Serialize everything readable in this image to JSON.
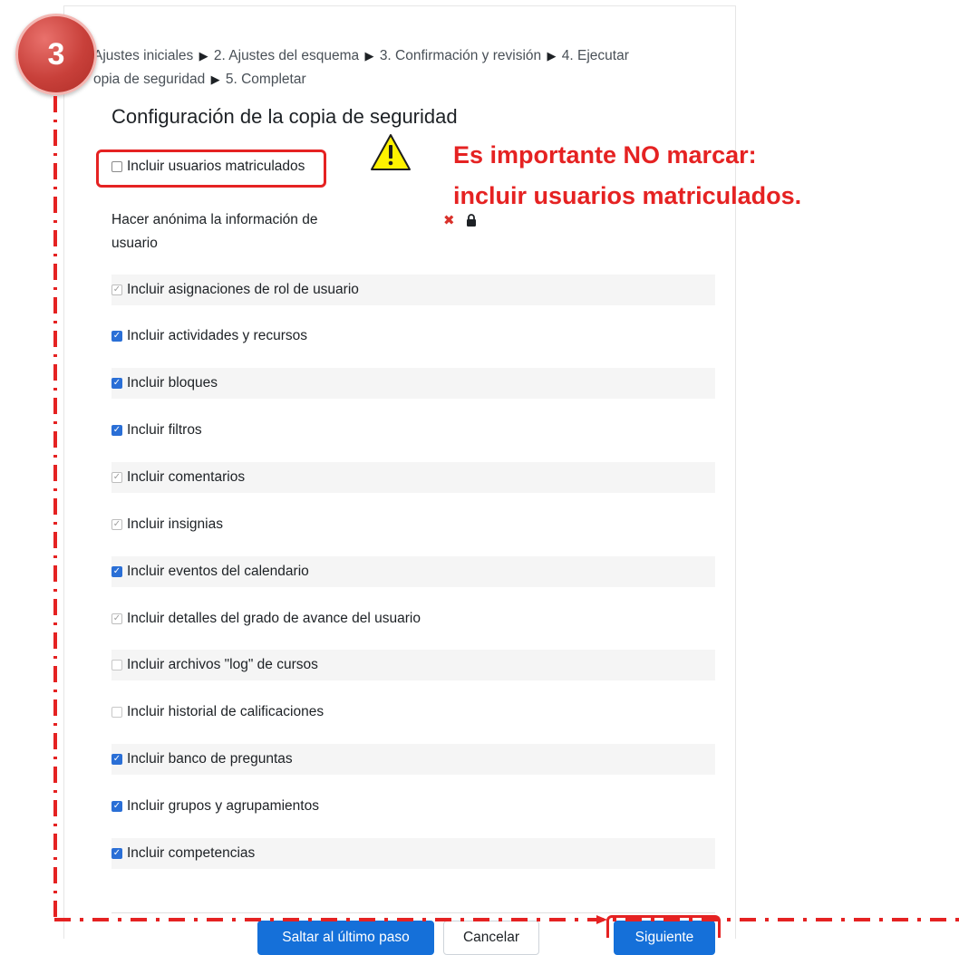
{
  "breadcrumb": {
    "steps": [
      "Ajustes iniciales",
      "2. Ajustes del esquema",
      "3. Confirmación y revisión",
      "4. Ejecutar",
      "opia de seguridad",
      "5. Completar"
    ]
  },
  "section_title": "Configuración de la copia de seguridad",
  "settings": {
    "include_users": {
      "label": "Incluir usuarios matriculados",
      "checked": false
    },
    "anonymize": {
      "label_line1": "Hacer anónima la información de",
      "label_line2": "usuario"
    },
    "items": [
      {
        "label": "Incluir asignaciones de rol de usuario",
        "state": "checked-disabled"
      },
      {
        "label": "Incluir actividades y recursos",
        "state": "checked"
      },
      {
        "label": "Incluir bloques",
        "state": "checked"
      },
      {
        "label": "Incluir filtros",
        "state": "checked"
      },
      {
        "label": "Incluir comentarios",
        "state": "checked-disabled"
      },
      {
        "label": "Incluir insignias",
        "state": "checked-disabled"
      },
      {
        "label": "Incluir eventos del calendario",
        "state": "checked"
      },
      {
        "label": "Incluir detalles del grado de avance del usuario",
        "state": "checked-disabled"
      },
      {
        "label": "Incluir archivos \"log\" de cursos",
        "state": "unchecked-disabled"
      },
      {
        "label": "Incluir historial de calificaciones",
        "state": "unchecked-disabled"
      },
      {
        "label": "Incluir banco de preguntas",
        "state": "checked"
      },
      {
        "label": "Incluir grupos y agrupamientos",
        "state": "checked"
      },
      {
        "label": "Incluir competencias",
        "state": "checked"
      }
    ]
  },
  "buttons": {
    "skip": "Saltar al último paso",
    "cancel": "Cancelar",
    "next": "Siguiente"
  },
  "annotation": {
    "step_number": "3",
    "warning_line1": "Es importante NO marcar:",
    "warning_line2": "incluir usuarios matriculados.",
    "color": "#e52222"
  },
  "colors": {
    "primary": "#1570d9",
    "checkbox": "#2a6fd6"
  }
}
